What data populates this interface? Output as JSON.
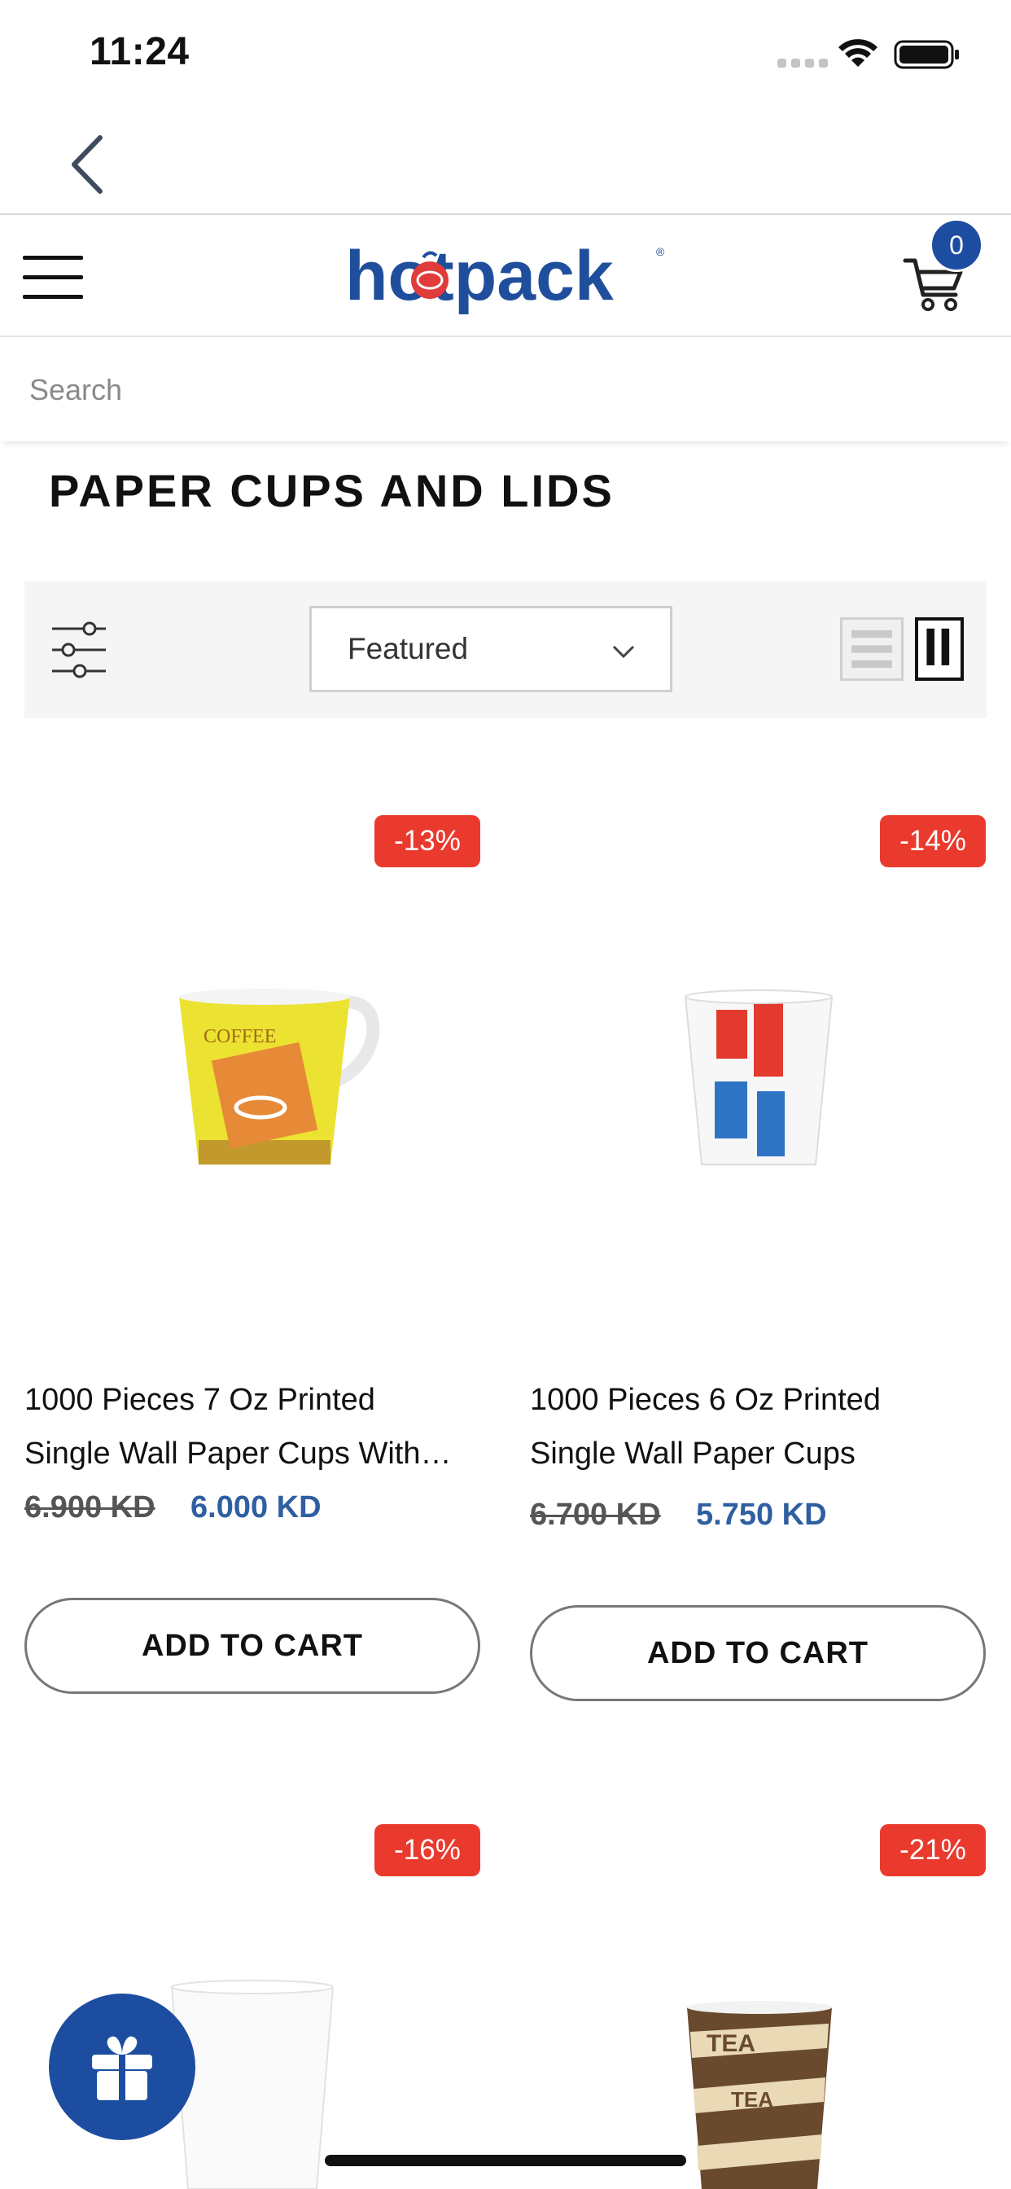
{
  "status_bar": {
    "time": "11:24"
  },
  "header": {
    "logo_text": "hotpack",
    "cart_count": "0"
  },
  "search": {
    "placeholder": "Search"
  },
  "page": {
    "title": "PAPER CUPS AND LIDS"
  },
  "toolbar": {
    "sort_selected": "Featured"
  },
  "products": [
    {
      "discount": "-13%",
      "name_line1": "1000 Pieces 7 Oz Printed",
      "name_line2": "Single Wall Paper Cups With…",
      "price_old": "6.900 KD",
      "price_new": "6.000 KD",
      "button": "ADD TO CART"
    },
    {
      "discount": "-14%",
      "name_line1": "1000 Pieces 6 Oz Printed",
      "name_line2": "Single Wall Paper Cups",
      "price_old": "6.700 KD",
      "price_new": "5.750 KD",
      "button": "ADD TO CART"
    },
    {
      "discount": "-16%"
    },
    {
      "discount": "-21%"
    }
  ],
  "colors": {
    "brand_blue": "#1c4da0",
    "discount_red": "#ea3a2e",
    "price_blue": "#2f5fa1"
  },
  "icons": [
    "back-chevron-icon",
    "menu-icon",
    "cart-icon",
    "filter-sliders-icon",
    "chevron-down-icon",
    "list-view-icon",
    "grid-view-icon",
    "gift-icon"
  ]
}
